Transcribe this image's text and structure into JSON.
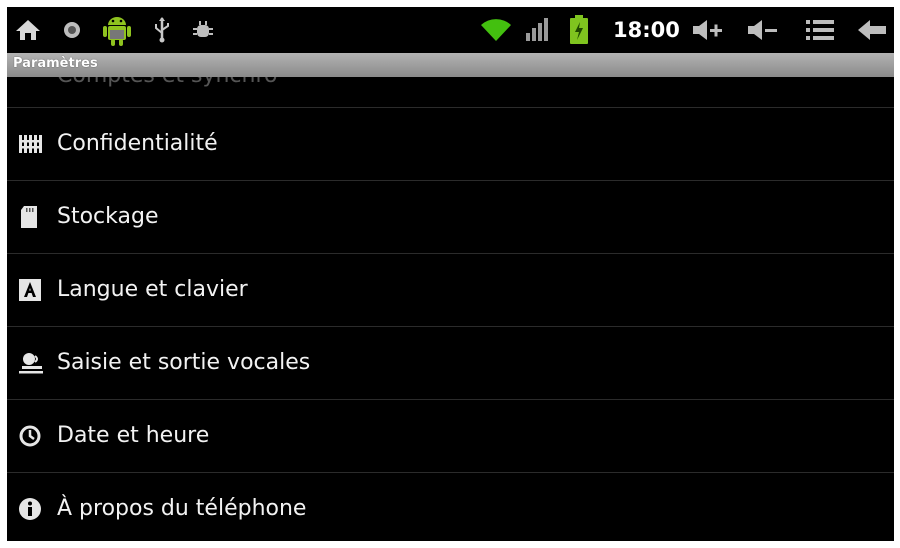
{
  "status_bar": {
    "time": "18:00",
    "icons": [
      "home-icon",
      "record-icon",
      "android-icon",
      "usb-icon",
      "bug-icon",
      "wifi-icon",
      "signal-icon",
      "battery-icon",
      "volume-up-icon",
      "volume-down-icon",
      "menu-icon",
      "back-icon"
    ],
    "wifi_color": "#43c00f",
    "battery_color": "#7fc41f"
  },
  "title_bar": {
    "title": "Paramètres"
  },
  "settings": {
    "partial_item": "Comptes et synchro",
    "items": [
      {
        "label": "Confidentialité",
        "icon": "privacy-icon"
      },
      {
        "label": "Stockage",
        "icon": "storage-icon"
      },
      {
        "label": "Langue et clavier",
        "icon": "language-icon"
      },
      {
        "label": "Saisie et sortie vocales",
        "icon": "voice-icon"
      },
      {
        "label": "Date et heure",
        "icon": "clock-icon"
      },
      {
        "label": "À propos du téléphone",
        "icon": "info-icon"
      }
    ]
  }
}
